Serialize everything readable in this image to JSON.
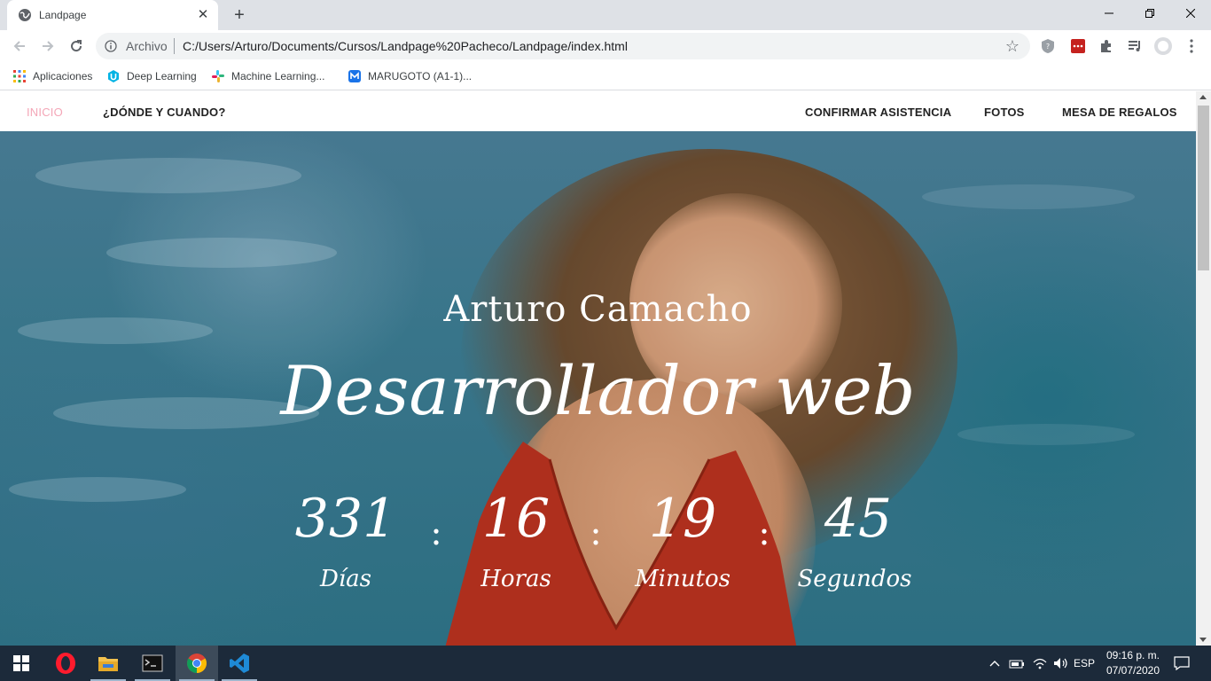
{
  "browser": {
    "tab": {
      "title": "Landpage",
      "favicon": "globe-icon"
    },
    "address": {
      "scheme_label": "Archivo",
      "url": "C:/Users/Arturo/Documents/Cursos/Landpage%20Pacheco/Landpage/index.html"
    },
    "bookmarks": [
      {
        "label": "Aplicaciones",
        "icon": "apps-grid-icon"
      },
      {
        "label": "Deep Learning",
        "icon": "udacity-icon"
      },
      {
        "label": "Machine Learning...",
        "icon": "slack-icon"
      },
      {
        "label": "MARUGOTO (A1-1)...",
        "icon": "marugoto-icon"
      }
    ]
  },
  "site": {
    "nav": {
      "inicio": "INICIO",
      "donde": "¿DÓNDE Y CUANDO?",
      "confirmar": "CONFIRMAR ASISTENCIA",
      "fotos": "FOTOS",
      "mesa": "MESA DE REGALOS"
    },
    "hero": {
      "name": "Arturo Camacho",
      "role": "Desarrollador web",
      "countdown": [
        {
          "value": "331",
          "label": "Días"
        },
        {
          "value": "16",
          "label": "Horas"
        },
        {
          "value": "19",
          "label": "Minutos"
        },
        {
          "value": "45",
          "label": "Segundos"
        }
      ],
      "separator": ":"
    },
    "colors": {
      "nav_active": "#f4a6b7",
      "hero_text": "#ffffff"
    }
  },
  "taskbar": {
    "apps": [
      "windows-start-icon",
      "opera-icon",
      "file-explorer-icon",
      "terminal-icon",
      "chrome-icon",
      "vscode-icon"
    ],
    "language": "ESP",
    "time": "09:16 p. m.",
    "date": "07/07/2020"
  }
}
